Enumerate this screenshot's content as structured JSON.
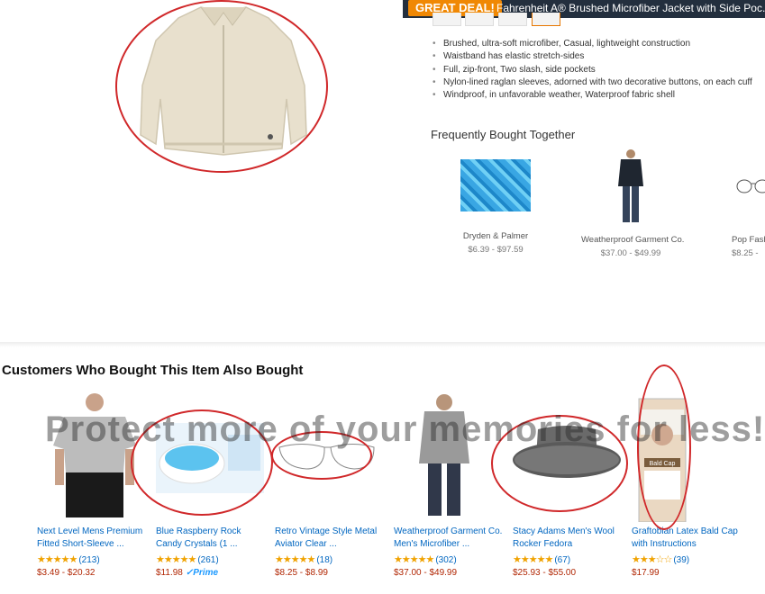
{
  "deal_bar": {
    "badge": "GREAT DEAL!",
    "title": "Fahrenheit A® Brushed Microfiber Jacket with Side Poc..."
  },
  "bullets": [
    "Brushed, ultra-soft microfiber, Casual, lightweight construction",
    "Waistband has elastic stretch-sides",
    "Full, zip-front, Two slash, side pockets",
    "Nylon-lined raglan sleeves, adorned with two decorative buttons, on each cuff",
    "Windproof, in unfavorable weather, Waterproof fabric shell"
  ],
  "fbt": {
    "title": "Frequently Bought Together",
    "items": [
      {
        "name": "Dryden & Palmer",
        "price": "$6.39 - $97.59",
        "icon": "blue-rock-candy-image"
      },
      {
        "name": "Weatherproof Garment Co.",
        "price": "$37.00 - $49.99",
        "icon": "man-in-jacket-image"
      },
      {
        "name": "Pop Fash",
        "price": "$8.25 -",
        "icon": "aviator-glasses-image"
      }
    ]
  },
  "cwb": {
    "title": "Customers Who Bought This Item Also Bought",
    "watermark": "Protect more of your memories for less!",
    "items": [
      {
        "l1": "Next Level Mens Premium",
        "l2": "Fitted Short-Sleeve ...",
        "stars": "★★★★★",
        "rating": 4.5,
        "count": "(213)",
        "price": "$3.49 - $20.32",
        "prime": ""
      },
      {
        "l1": "Blue Raspberry Rock",
        "l2": "Candy Crystals (1 ...",
        "stars": "★★★★★",
        "rating": 4.5,
        "count": "(261)",
        "price": "$11.98",
        "prime": "✓Prime"
      },
      {
        "l1": "Retro Vintage Style Metal",
        "l2": "Aviator Clear ...",
        "stars": "★★★★★",
        "rating": 4.5,
        "count": "(18)",
        "price": "$8.25 - $8.99",
        "prime": ""
      },
      {
        "l1": "Weatherproof Garment Co.",
        "l2": "Men's Microfiber ...",
        "stars": "★★★★★",
        "rating": 4.5,
        "count": "(302)",
        "price": "$37.00 - $49.99",
        "prime": ""
      },
      {
        "l1": "Stacy Adams Men's Wool",
        "l2": "Rocker Fedora",
        "stars": "★★★★★",
        "rating": 4.5,
        "count": "(67)",
        "price": "$25.93 - $55.00",
        "prime": ""
      },
      {
        "l1": "Graftobian Latex Bald Cap",
        "l2": "with Instructions",
        "stars": "★★★☆☆",
        "rating": 3.5,
        "count": "(39)",
        "price": "$17.99",
        "prime": ""
      }
    ]
  },
  "bald_cap_label": "Bald Cap",
  "colors": {
    "link": "#0066c0",
    "price": "#b12704",
    "star": "#f0a200",
    "annotation": "#d0282a",
    "deal": "#f08804"
  }
}
